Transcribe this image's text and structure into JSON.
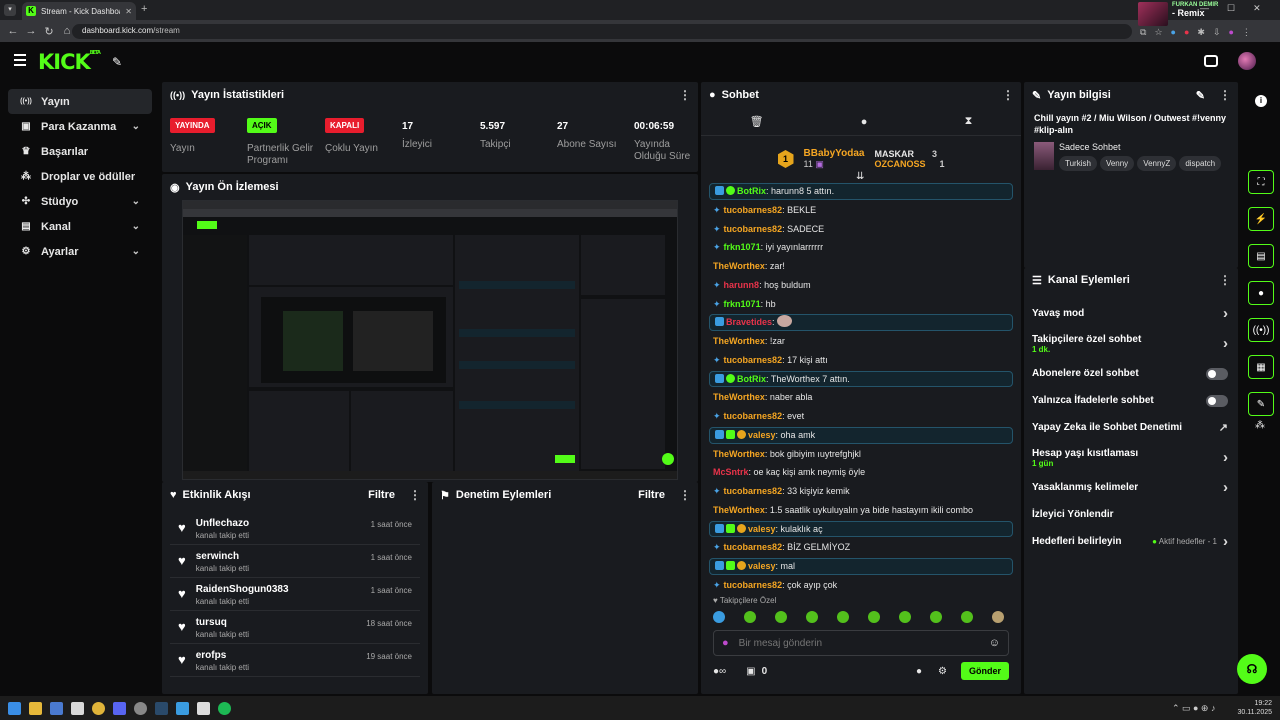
{
  "browser": {
    "tab_title": "Stream - Kick Dashboard",
    "url_host": "dashboard.kick.com",
    "url_path": "/stream",
    "now_playing_artist": "FURKAN DEMIR",
    "now_playing_title": "- Remix"
  },
  "brand": {
    "logo": "KICK",
    "beta": "BETA",
    "accent": "#53fc18"
  },
  "sidebar": {
    "items": [
      {
        "label": "Yayın",
        "icon": "broadcast-icon",
        "active": true,
        "has_chevron": false
      },
      {
        "label": "Para Kazanma",
        "icon": "money-icon",
        "has_chevron": true
      },
      {
        "label": "Başarılar",
        "icon": "trophy-icon",
        "has_chevron": false
      },
      {
        "label": "Droplar ve ödüller",
        "icon": "drops-icon",
        "has_chevron": false
      },
      {
        "label": "Stüdyo",
        "icon": "studio-icon",
        "has_chevron": true
      },
      {
        "label": "Kanal",
        "icon": "channel-icon",
        "has_chevron": true
      },
      {
        "label": "Ayarlar",
        "icon": "gear-icon",
        "has_chevron": true
      }
    ]
  },
  "stats": {
    "title": "Yayın İstatistikleri",
    "items": [
      {
        "pill": "YAYINDA",
        "pill_color": "#e81d2d",
        "label": "Yayın"
      },
      {
        "pill": "AÇIK",
        "pill_color": "#53fc18",
        "label": "Partnerlik Gelir Programı"
      },
      {
        "pill": "KAPALI",
        "pill_color": "#e81d2d",
        "label": "Çoklu Yayın"
      },
      {
        "value": "17",
        "label": "İzleyici"
      },
      {
        "value": "5.597",
        "label": "Takipçi"
      },
      {
        "value": "27",
        "label": "Abone Sayısı"
      },
      {
        "value": "00:06:59",
        "label": "Yayında Olduğu Süre"
      }
    ]
  },
  "preview": {
    "title": "Yayın Ön İzlemesi"
  },
  "activity": {
    "title": "Etkinlik Akışı",
    "filter": "Filtre",
    "items": [
      {
        "name": "Unflechazo",
        "action": "kanalı takip etti",
        "time": "1 saat önce"
      },
      {
        "name": "serwinch",
        "action": "kanalı takip etti",
        "time": "1 saat önce"
      },
      {
        "name": "RaidenShogun0383",
        "action": "kanalı takip etti",
        "time": "1 saat önce"
      },
      {
        "name": "tursuq",
        "action": "kanalı takip etti",
        "time": "18 saat önce"
      },
      {
        "name": "erofps",
        "action": "kanalı takip etti",
        "time": "19 saat önce"
      }
    ]
  },
  "moderation": {
    "title": "Denetim Eylemleri",
    "filter": "Filtre"
  },
  "chat": {
    "title": "Sohbet",
    "leaderboard": {
      "top_name": "BBabyYodaa",
      "top_count": "11",
      "second_name": "MASKAR",
      "second_count": "3",
      "third_name": "OZCANOSS",
      "third_count": "1"
    },
    "messages": [
      {
        "user": "BotRix",
        "color": "#53fc18",
        "badges": "bot",
        "text": "harunn8 5 attın.",
        "highlight": true
      },
      {
        "user": "tucobarnes82",
        "color": "#f5a623",
        "badges": "diamond",
        "text": "BEKLE"
      },
      {
        "user": "tucobarnes82",
        "color": "#f5a623",
        "badges": "diamond",
        "text": "SADECE"
      },
      {
        "user": "frkn1071",
        "color": "#53fc18",
        "badges": "diamond",
        "text": "iyi yayınlarrrrrr"
      },
      {
        "user": "TheWorthex",
        "color": "#f5a623",
        "badges": "",
        "text": "zar!"
      },
      {
        "user": "harunn8",
        "color": "#e8334a",
        "badges": "diamond",
        "text": "hoş buldum"
      },
      {
        "user": "frkn1071",
        "color": "#53fc18",
        "badges": "diamond",
        "text": "hb"
      },
      {
        "user": "Bravetides",
        "color": "#e8334a",
        "badges": "mod",
        "text": "",
        "emote": true,
        "highlight": true
      },
      {
        "user": "TheWorthex",
        "color": "#f5a623",
        "badges": "",
        "text": "!zar"
      },
      {
        "user": "tucobarnes82",
        "color": "#f5a623",
        "badges": "diamond",
        "text": "17 kişi attı"
      },
      {
        "user": "BotRix",
        "color": "#53fc18",
        "badges": "modbot",
        "text": "TheWorthex 7 attın.",
        "highlight": true
      },
      {
        "user": "TheWorthex",
        "color": "#f5a623",
        "badges": "",
        "text": "naber abla"
      },
      {
        "user": "tucobarnes82",
        "color": "#f5a623",
        "badges": "diamond",
        "text": "evet"
      },
      {
        "user": "valesy",
        "color": "#f5a623",
        "badges": "full",
        "text": "oha amk",
        "highlight": true
      },
      {
        "user": "TheWorthex",
        "color": "#f5a623",
        "badges": "",
        "text": "bok gibiyim ıuytrefghjkl"
      },
      {
        "user": "McSntrk",
        "color": "#e8334a",
        "badges": "",
        "text": "oe kaç kişi amk neymiş öyle"
      },
      {
        "user": "tucobarnes82",
        "color": "#f5a623",
        "badges": "diamond",
        "text": "33 kişiyiz kemik"
      },
      {
        "user": "TheWorthex",
        "color": "#f5a623",
        "badges": "",
        "text": "1.5 saatlik uykuluyalın ya bide hastayım ikili combo"
      },
      {
        "user": "valesy",
        "color": "#f5a623",
        "badges": "full",
        "text": "kulaklık aç",
        "highlight": true
      },
      {
        "user": "tucobarnes82",
        "color": "#f5a623",
        "badges": "diamond",
        "text": "BİZ GELMİYOZ"
      },
      {
        "user": "valesy",
        "color": "#f5a623",
        "badges": "full",
        "text": "mal",
        "highlight": true
      },
      {
        "user": "tucobarnes82",
        "color": "#f5a623",
        "badges": "diamond",
        "text": "çok ayıp çok"
      }
    ],
    "followers_only": "Takipçilere Özel",
    "input_placeholder": "Bir mesaj gönderin",
    "points": "0",
    "send": "Gönder"
  },
  "stream_info": {
    "title": "Yayın bilgisi",
    "stream_title": "Chill yayın #2 / Miu Wilson / Outwest #!venny #klip-alın",
    "category": "Sadece Sohbet",
    "tags": [
      "Turkish",
      "Venny",
      "VennyZ",
      "dispatch"
    ]
  },
  "channel_actions": {
    "title": "Kanal Eylemleri",
    "rows": [
      {
        "label": "Yavaş mod",
        "type": "arrow"
      },
      {
        "label": "Takipçilere özel sohbet",
        "sub": "1 dk.",
        "type": "arrow"
      },
      {
        "label": "Abonelere özel sohbet",
        "type": "toggle"
      },
      {
        "label": "Yalnızca İfadelerle sohbet",
        "type": "toggle"
      },
      {
        "label": "Yapay Zeka ile Sohbet Denetimi",
        "type": "external"
      },
      {
        "label": "Hesap yaşı kısıtlaması",
        "sub": "1 gün",
        "type": "arrow"
      },
      {
        "label": "Yasaklanmış kelimeler",
        "type": "arrow"
      },
      {
        "label": "İzleyici Yönlendir",
        "type": "none"
      },
      {
        "label": "Hedefleri belirleyin",
        "status": "Aktif hedefler - 1",
        "type": "arrow"
      }
    ]
  },
  "taskbar": {
    "time": "19:22",
    "date": "30.11.2025"
  }
}
